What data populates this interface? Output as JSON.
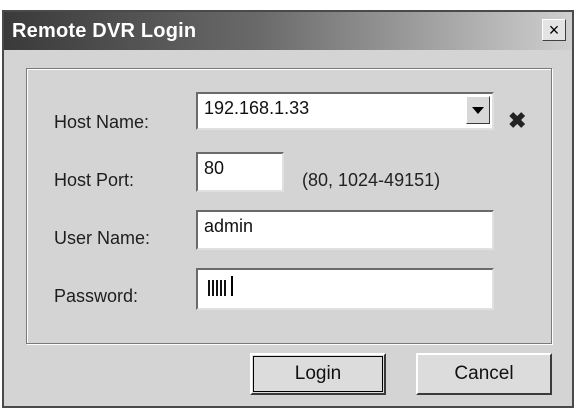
{
  "window": {
    "title": "Remote DVR Login",
    "close_glyph": "×"
  },
  "form": {
    "host_name": {
      "label": "Host Name:",
      "value": "192.168.1.33"
    },
    "host_port": {
      "label": "Host Port:",
      "value": "80",
      "hint": "(80, 1024-49151)"
    },
    "user_name": {
      "label": "User Name:",
      "value": "admin"
    },
    "password": {
      "label": "Password:",
      "masked_length": 5
    }
  },
  "icons": {
    "clear": "clear-x-icon",
    "close": "close-icon",
    "dropdown": "chevron-down-icon"
  },
  "buttons": {
    "login": "Login",
    "cancel": "Cancel"
  }
}
